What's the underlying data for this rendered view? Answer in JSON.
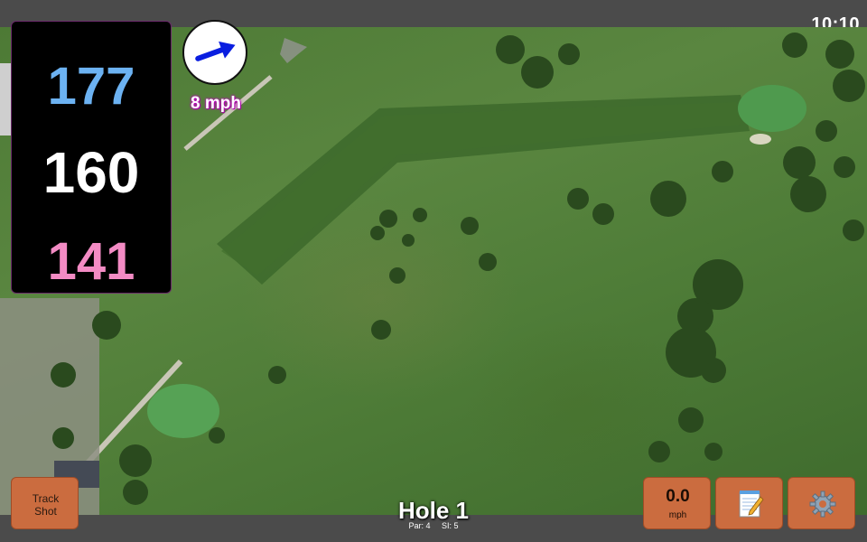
{
  "status": {
    "time": "10:10"
  },
  "yardages": {
    "back": "177",
    "middle": "160",
    "front": "141"
  },
  "wind": {
    "speed": "8 mph",
    "icon": "arrow-icon",
    "direction_deg": 60
  },
  "hole": {
    "title": "Hole 1",
    "par": "Par: 4",
    "si": "SI: 5"
  },
  "buttons": {
    "track_line1": "Track",
    "track_line2": "Shot",
    "speed_value": "0.0",
    "speed_unit": "mph",
    "notes_icon": "notepad-icon",
    "settings_icon": "gear-icon"
  },
  "colors": {
    "back_yardage": "#6cb2f2",
    "front_yardage": "#f38bc4",
    "button": "#cb6c3f"
  }
}
